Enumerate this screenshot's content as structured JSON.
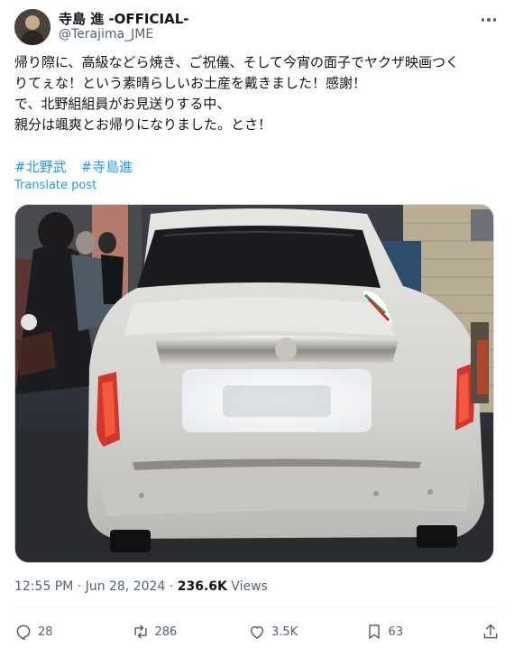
{
  "author": {
    "name": "寺島 進 -OFFICIAL-",
    "handle": "@Terajima_JME"
  },
  "tweet": {
    "lines": [
      "帰り際に、高級などら焼き、ご祝儀、そして今宵の面子でヤクザ映画つく",
      "りてぇな！という素晴らしいお土産を戴きました！感謝！",
      "で、北野組組員がお見送りする中、",
      "親分は颯爽とお帰りになりました。とさ！"
    ],
    "hashtags": [
      "#北野武",
      "#寺島進"
    ],
    "translate_label": "Translate post"
  },
  "meta": {
    "time": "12:55 PM",
    "separator": " · ",
    "date": "Jun 28, 2024",
    "views_count": "236.6K",
    "views_label": " Views"
  },
  "actions": {
    "replies": "28",
    "reposts": "286",
    "likes": "3.5K",
    "bookmarks": "63"
  },
  "icons": {
    "more": "more-dots-icon",
    "reply": "reply-icon",
    "repost": "repost-icon",
    "like": "heart-icon",
    "bookmark": "bookmark-icon",
    "share": "share-icon"
  }
}
